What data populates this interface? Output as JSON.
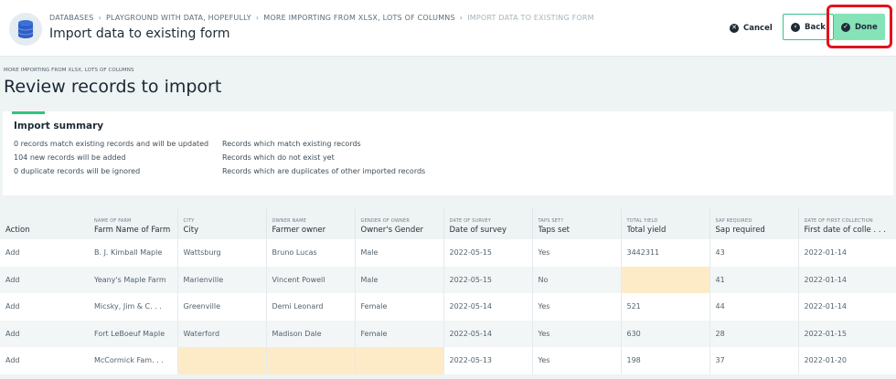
{
  "header": {
    "breadcrumbs": [
      "DATABASES",
      "PLAYGROUND WITH DATA, HOPEFULLY",
      "MORE IMPORTING FROM XLSX, LOTS OF COLUMNS",
      "IMPORT DATA TO EXISTING FORM"
    ],
    "separator": "›",
    "title": "Import data to existing form",
    "cancel_label": "Cancel",
    "back_label": "Back",
    "done_label": "Done"
  },
  "section": {
    "crumb": "MORE IMPORTING FROM XLSX, LOTS OF COLUMNS",
    "title": "Review records to import"
  },
  "summary": {
    "title": "Import summary",
    "rows": [
      {
        "count": "0 records match existing records and will be updated",
        "desc": "Records which match existing records"
      },
      {
        "count": "104 new records will be added",
        "desc": "Records which do not exist yet"
      },
      {
        "count": "0 duplicate records will be ignored",
        "desc": "Records which are duplicates of other imported records"
      }
    ]
  },
  "table": {
    "columns": [
      {
        "small": "",
        "big": "Action"
      },
      {
        "small": "NAME OF FARM",
        "big": "Farm Name of Farm"
      },
      {
        "small": "CITY",
        "big": "City"
      },
      {
        "small": "OWNER NAME",
        "big": "Farmer owner"
      },
      {
        "small": "GENDER OF OWNER",
        "big": "Owner's Gender"
      },
      {
        "small": "DATE OF SURVEY",
        "big": "Date of survey"
      },
      {
        "small": "TAPS SET?",
        "big": "Taps set"
      },
      {
        "small": "TOTAL YIELD",
        "big": "Total yield"
      },
      {
        "small": "SAP REQUIRED",
        "big": "Sap required"
      },
      {
        "small": "DATE OF FIRST COLLECTION",
        "big": "First date of colle . . ."
      }
    ],
    "rows": [
      [
        "Add",
        "B. J. Kimball Maple",
        "Wattsburg",
        "Bruno Lucas",
        "Male",
        "2022-05-15",
        "Yes",
        "3442311",
        "43",
        "2022-01-14"
      ],
      [
        "Add",
        "Yeany's Maple Farm",
        "Marienville",
        "Vincent Powell",
        "Male",
        "2022-05-15",
        "No",
        "",
        "41",
        "2022-01-14"
      ],
      [
        "Add",
        "Micsky, Jim & C. . .",
        "Greenville",
        "Demi Leonard",
        "Female",
        "2022-05-14",
        "Yes",
        "521",
        "44",
        "2022-01-14"
      ],
      [
        "Add",
        "Fort LeBoeuf Maple",
        "Waterford",
        "Madison Dale",
        "Female",
        "2022-05-14",
        "Yes",
        "630",
        "28",
        "2022-01-15"
      ],
      [
        "Add",
        "McCormick Fam. . .",
        "",
        "",
        "",
        "2022-05-13",
        "Yes",
        "198",
        "37",
        "2022-01-20"
      ]
    ],
    "missing_color": "#fdebc8"
  },
  "colors": {
    "accent": "#2ec57f",
    "done_bg": "#86e3b8",
    "highlight": "#e0141e"
  }
}
